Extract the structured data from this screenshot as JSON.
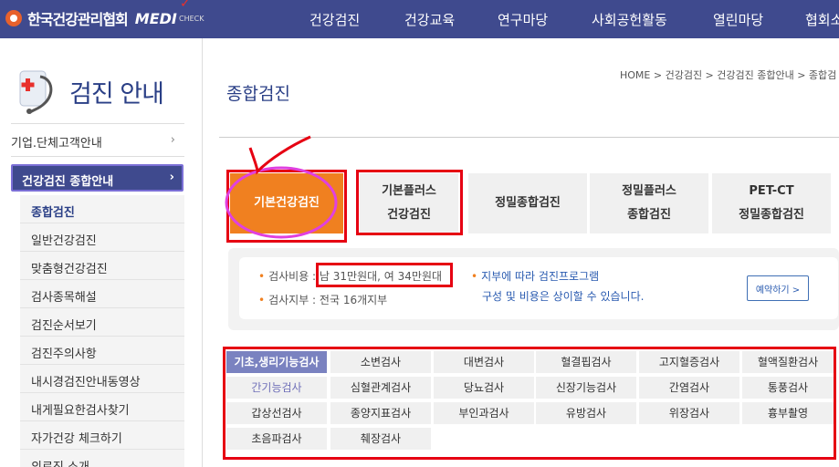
{
  "header": {
    "logo_text": "한국건강관리협회",
    "logo_medi": "MEDI",
    "logo_check": "CHECK",
    "nav": [
      "건강검진",
      "건강교육",
      "연구마당",
      "사회공헌활동",
      "열린마당",
      "협회소"
    ]
  },
  "sidebar": {
    "title": "검진 안내",
    "link_corp": "기업.단체고객안내",
    "active": "건강검진 종합안내",
    "items": [
      "종합검진",
      "일반건강검진",
      "맞춤형건강검진",
      "검사종목해설",
      "검진순서보기",
      "검진주의사항",
      "내시경검진안내동영상",
      "내게필요한검사찾기",
      "자가건강 체크하기",
      "의료진 소개"
    ]
  },
  "main": {
    "title": "종합검진",
    "breadcrumb": "HOME > 건강검진 > 건강검진 종합안내 > 종합검",
    "tabs": [
      {
        "line1": "기본건강검진",
        "line2": ""
      },
      {
        "line1": "기본플러스",
        "line2": "건강검진"
      },
      {
        "line1": "정밀종합검진",
        "line2": ""
      },
      {
        "line1": "정밀플러스",
        "line2": "종합검진"
      },
      {
        "line1": "PET-CT",
        "line2": "정밀종합검진"
      }
    ],
    "info": {
      "cost_label": "검사비용 : ",
      "cost_value": "남 31만원대, 여 34만원대",
      "branch_label": "검사지부 : ",
      "branch_value": "전국 16개지부",
      "note_line1": "지부에 따라 검진프로그램",
      "note_line2": "구성 및 비용은 상이할 수 있습니다.",
      "reserve_button": "예약하기 >"
    },
    "tests": [
      [
        "기초,생리기능검사",
        "소변검사",
        "대변검사",
        "혈결핍검사",
        "고지혈증검사",
        "혈액질환검사"
      ],
      [
        "간기능검사",
        "심혈관계검사",
        "당뇨검사",
        "신장기능검사",
        "간염검사",
        "통풍검사"
      ],
      [
        "갑상선검사",
        "종양지표검사",
        "부인과검사",
        "유방검사",
        "위장검사",
        "흉부촬영"
      ],
      [
        "초음파검사",
        "췌장검사"
      ]
    ]
  },
  "colors": {
    "brand": "#3f4a8e",
    "accent": "#f08020",
    "annotation": "#e60012",
    "annotation_pink": "#e040e0"
  }
}
